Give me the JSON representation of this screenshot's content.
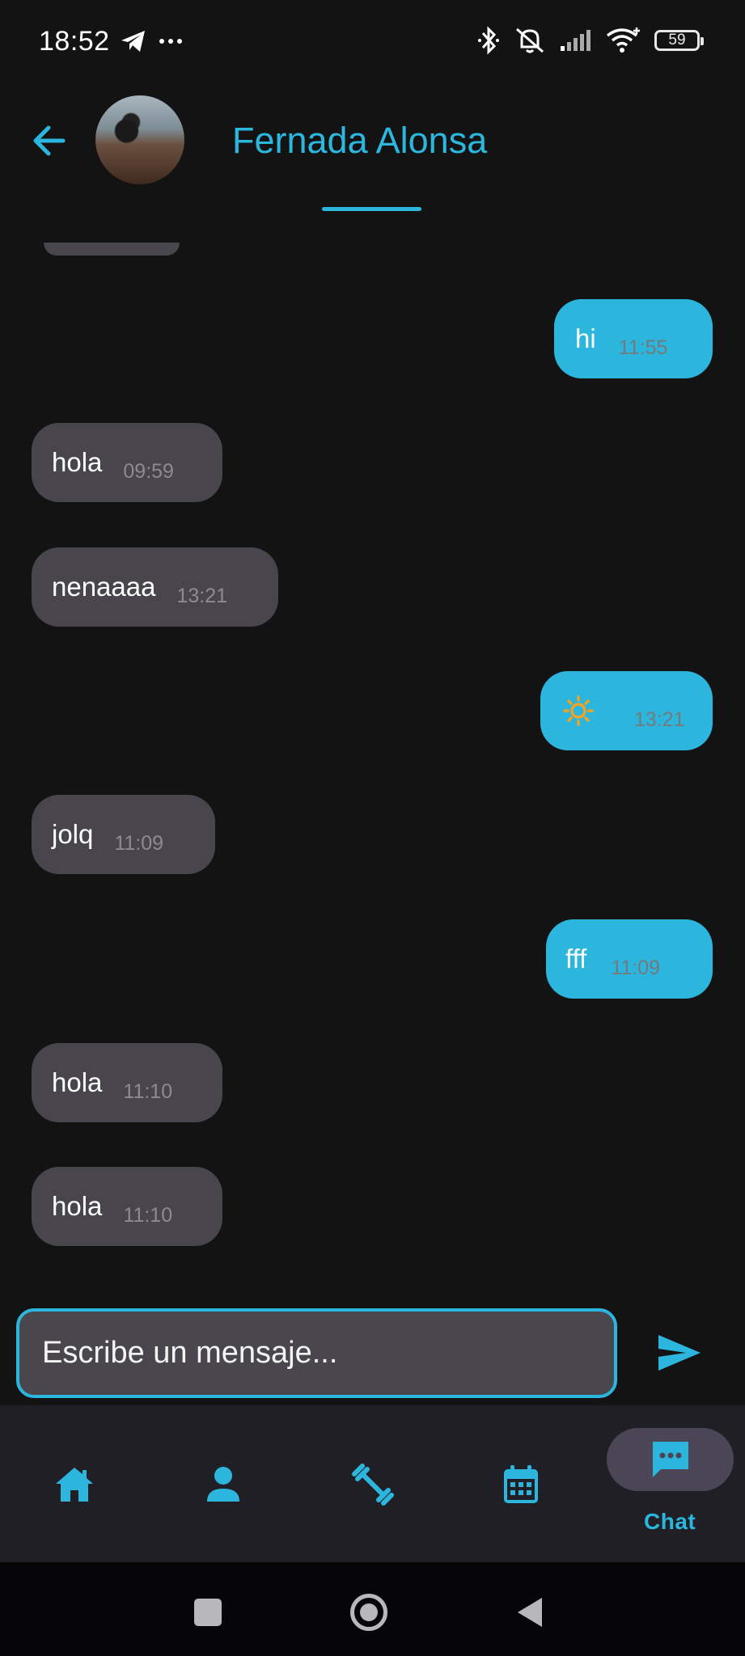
{
  "status_bar": {
    "time": "18:52",
    "left_icons": [
      "telegram-icon",
      "more-dots-icon"
    ],
    "right_icons": [
      "bluetooth-icon",
      "bell-off-icon",
      "signal-icon",
      "wifi-icon"
    ],
    "battery": "59"
  },
  "header": {
    "contact_name": "Fernada Alonsa"
  },
  "messages": [
    {
      "direction": "out",
      "text": "hi",
      "time": "11:55"
    },
    {
      "direction": "in",
      "text": "hola",
      "time": "09:59"
    },
    {
      "direction": "in",
      "text": "nenaaaa",
      "time": "13:21"
    },
    {
      "direction": "out",
      "text": "",
      "icon": "sun-icon",
      "time": "13:21"
    },
    {
      "direction": "in",
      "text": "jolq",
      "time": "11:09"
    },
    {
      "direction": "out",
      "text": "fff",
      "time": "11:09"
    },
    {
      "direction": "in",
      "text": "hola",
      "time": "11:10"
    },
    {
      "direction": "in",
      "text": "hola",
      "time": "11:10"
    }
  ],
  "composer": {
    "placeholder": "Escribe un mensaje..."
  },
  "bottom_nav": {
    "items": [
      {
        "icon": "home-icon"
      },
      {
        "icon": "person-icon"
      },
      {
        "icon": "dumbbell-icon"
      },
      {
        "icon": "calendar-icon"
      },
      {
        "icon": "chat-icon",
        "label": "Chat",
        "active": true
      }
    ]
  },
  "colors": {
    "accent": "#2cb6dd",
    "background": "#131313",
    "incoming_bubble": "#48454c"
  }
}
